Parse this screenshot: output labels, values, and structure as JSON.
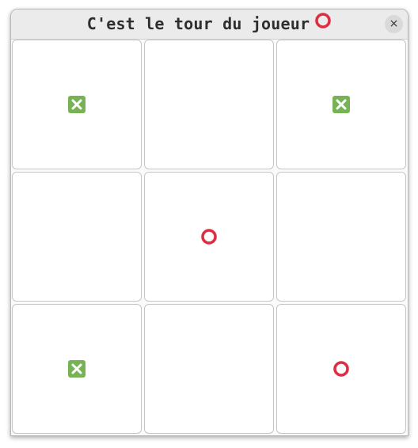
{
  "window": {
    "title": "C'est le tour du joueur",
    "current_player_mark": "O",
    "close_label": "×"
  },
  "board": {
    "cells": [
      "X",
      "",
      "X",
      "",
      "O",
      "",
      "X",
      "",
      "O"
    ]
  },
  "colors": {
    "x_mark": "#77b255",
    "o_mark": "#dd2e44"
  }
}
